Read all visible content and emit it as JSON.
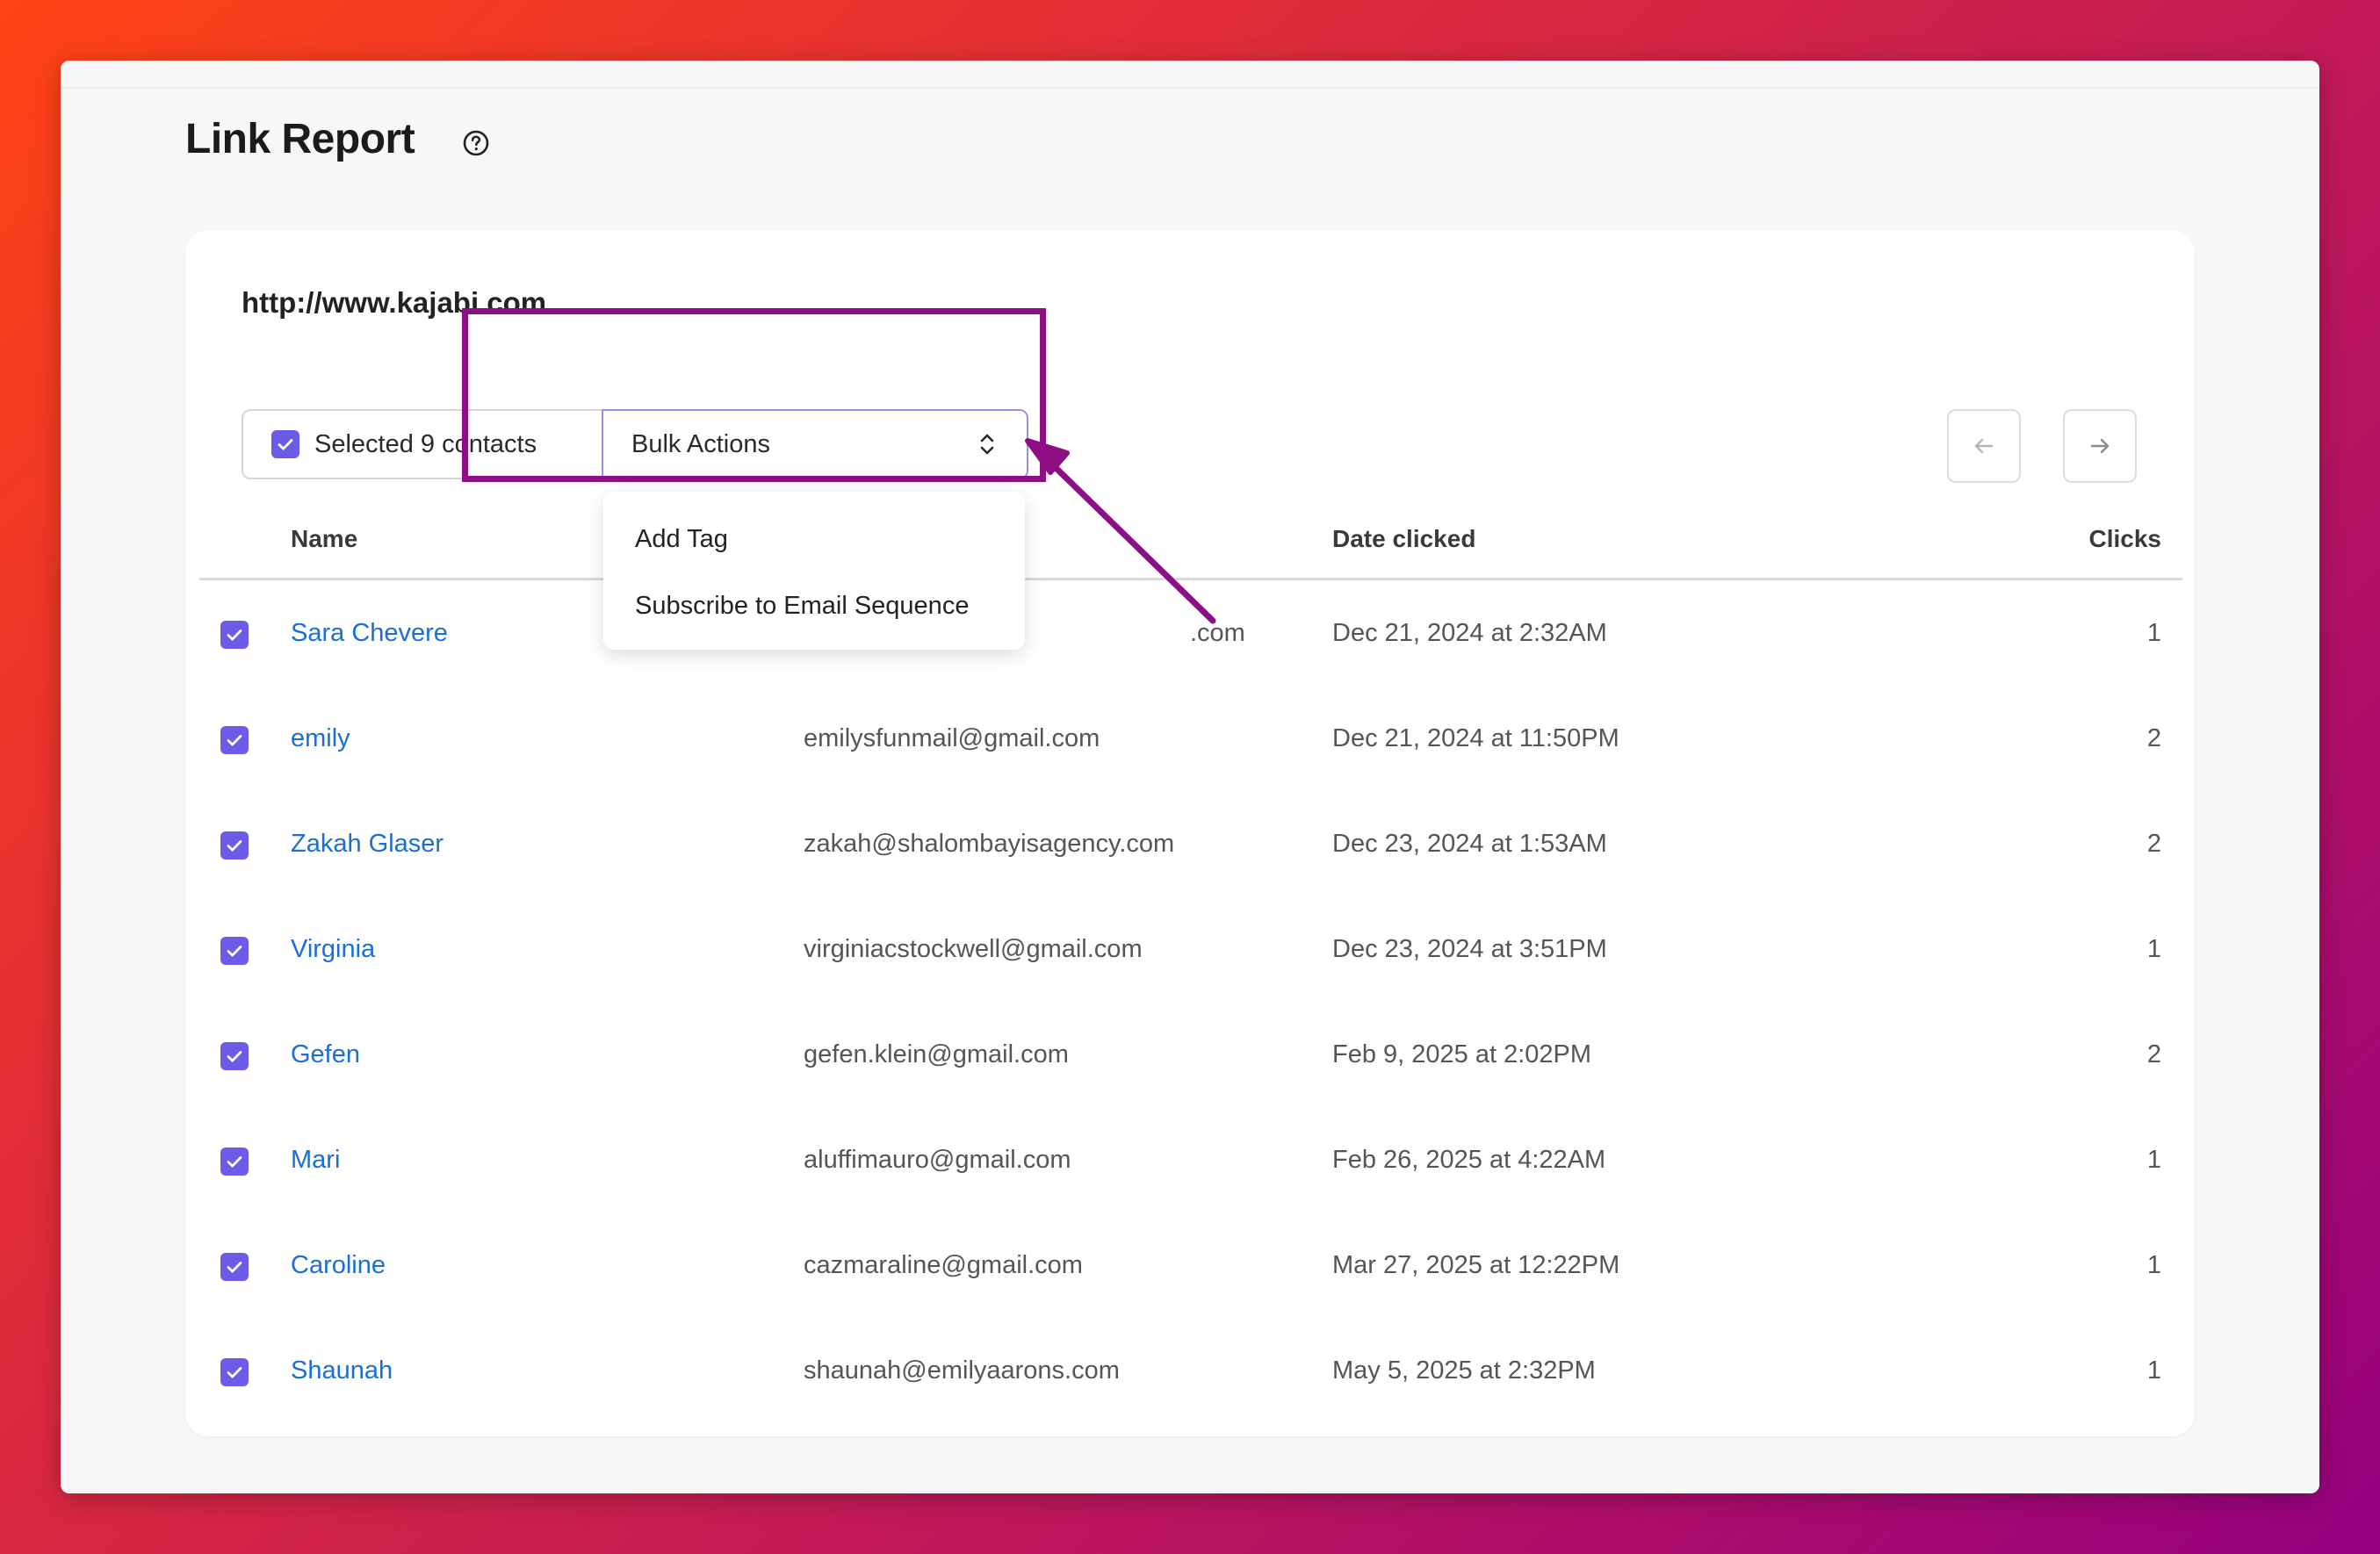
{
  "page": {
    "title": "Link Report",
    "help_icon": "question-circle-icon"
  },
  "report": {
    "url": "http://www.kajabi.com"
  },
  "toolbar": {
    "selected_label": "Selected 9 contacts",
    "bulk_actions_label": "Bulk Actions",
    "bulk_actions_menu": [
      "Add Tag",
      "Subscribe to Email Sequence"
    ],
    "prev_icon": "arrow-left-icon",
    "next_icon": "arrow-right-icon"
  },
  "table": {
    "columns": [
      "Name",
      "Date clicked",
      "Clicks"
    ],
    "rows": [
      {
        "name": "Sara Chevere",
        "email": ".com",
        "date": "Dec 21, 2024 at 2:32AM",
        "clicks": "1"
      },
      {
        "name": "emily",
        "email": "emilysfunmail@gmail.com",
        "date": "Dec 21, 2024 at 11:50PM",
        "clicks": "2"
      },
      {
        "name": "Zakah Glaser",
        "email": "zakah@shalombayisagency.com",
        "date": "Dec 23, 2024 at 1:53AM",
        "clicks": "2"
      },
      {
        "name": "Virginia",
        "email": "virginiacstockwell@gmail.com",
        "date": "Dec 23, 2024 at 3:51PM",
        "clicks": "1"
      },
      {
        "name": "Gefen",
        "email": "gefen.klein@gmail.com",
        "date": "Feb 9, 2025 at 2:02PM",
        "clicks": "2"
      },
      {
        "name": "Mari",
        "email": "aluffimauro@gmail.com",
        "date": "Feb 26, 2025 at 4:22AM",
        "clicks": "1"
      },
      {
        "name": "Caroline",
        "email": "cazmaraline@gmail.com",
        "date": "Mar 27, 2025 at 12:22PM",
        "clicks": "1"
      },
      {
        "name": "Shaunah",
        "email": "shaunah@emilyaarons.com",
        "date": "May 5, 2025 at 2:32PM",
        "clicks": "1"
      }
    ]
  },
  "colors": {
    "accent": "#6b5ce7",
    "link": "#1a6fd6",
    "annotation": "#8e0f84"
  }
}
